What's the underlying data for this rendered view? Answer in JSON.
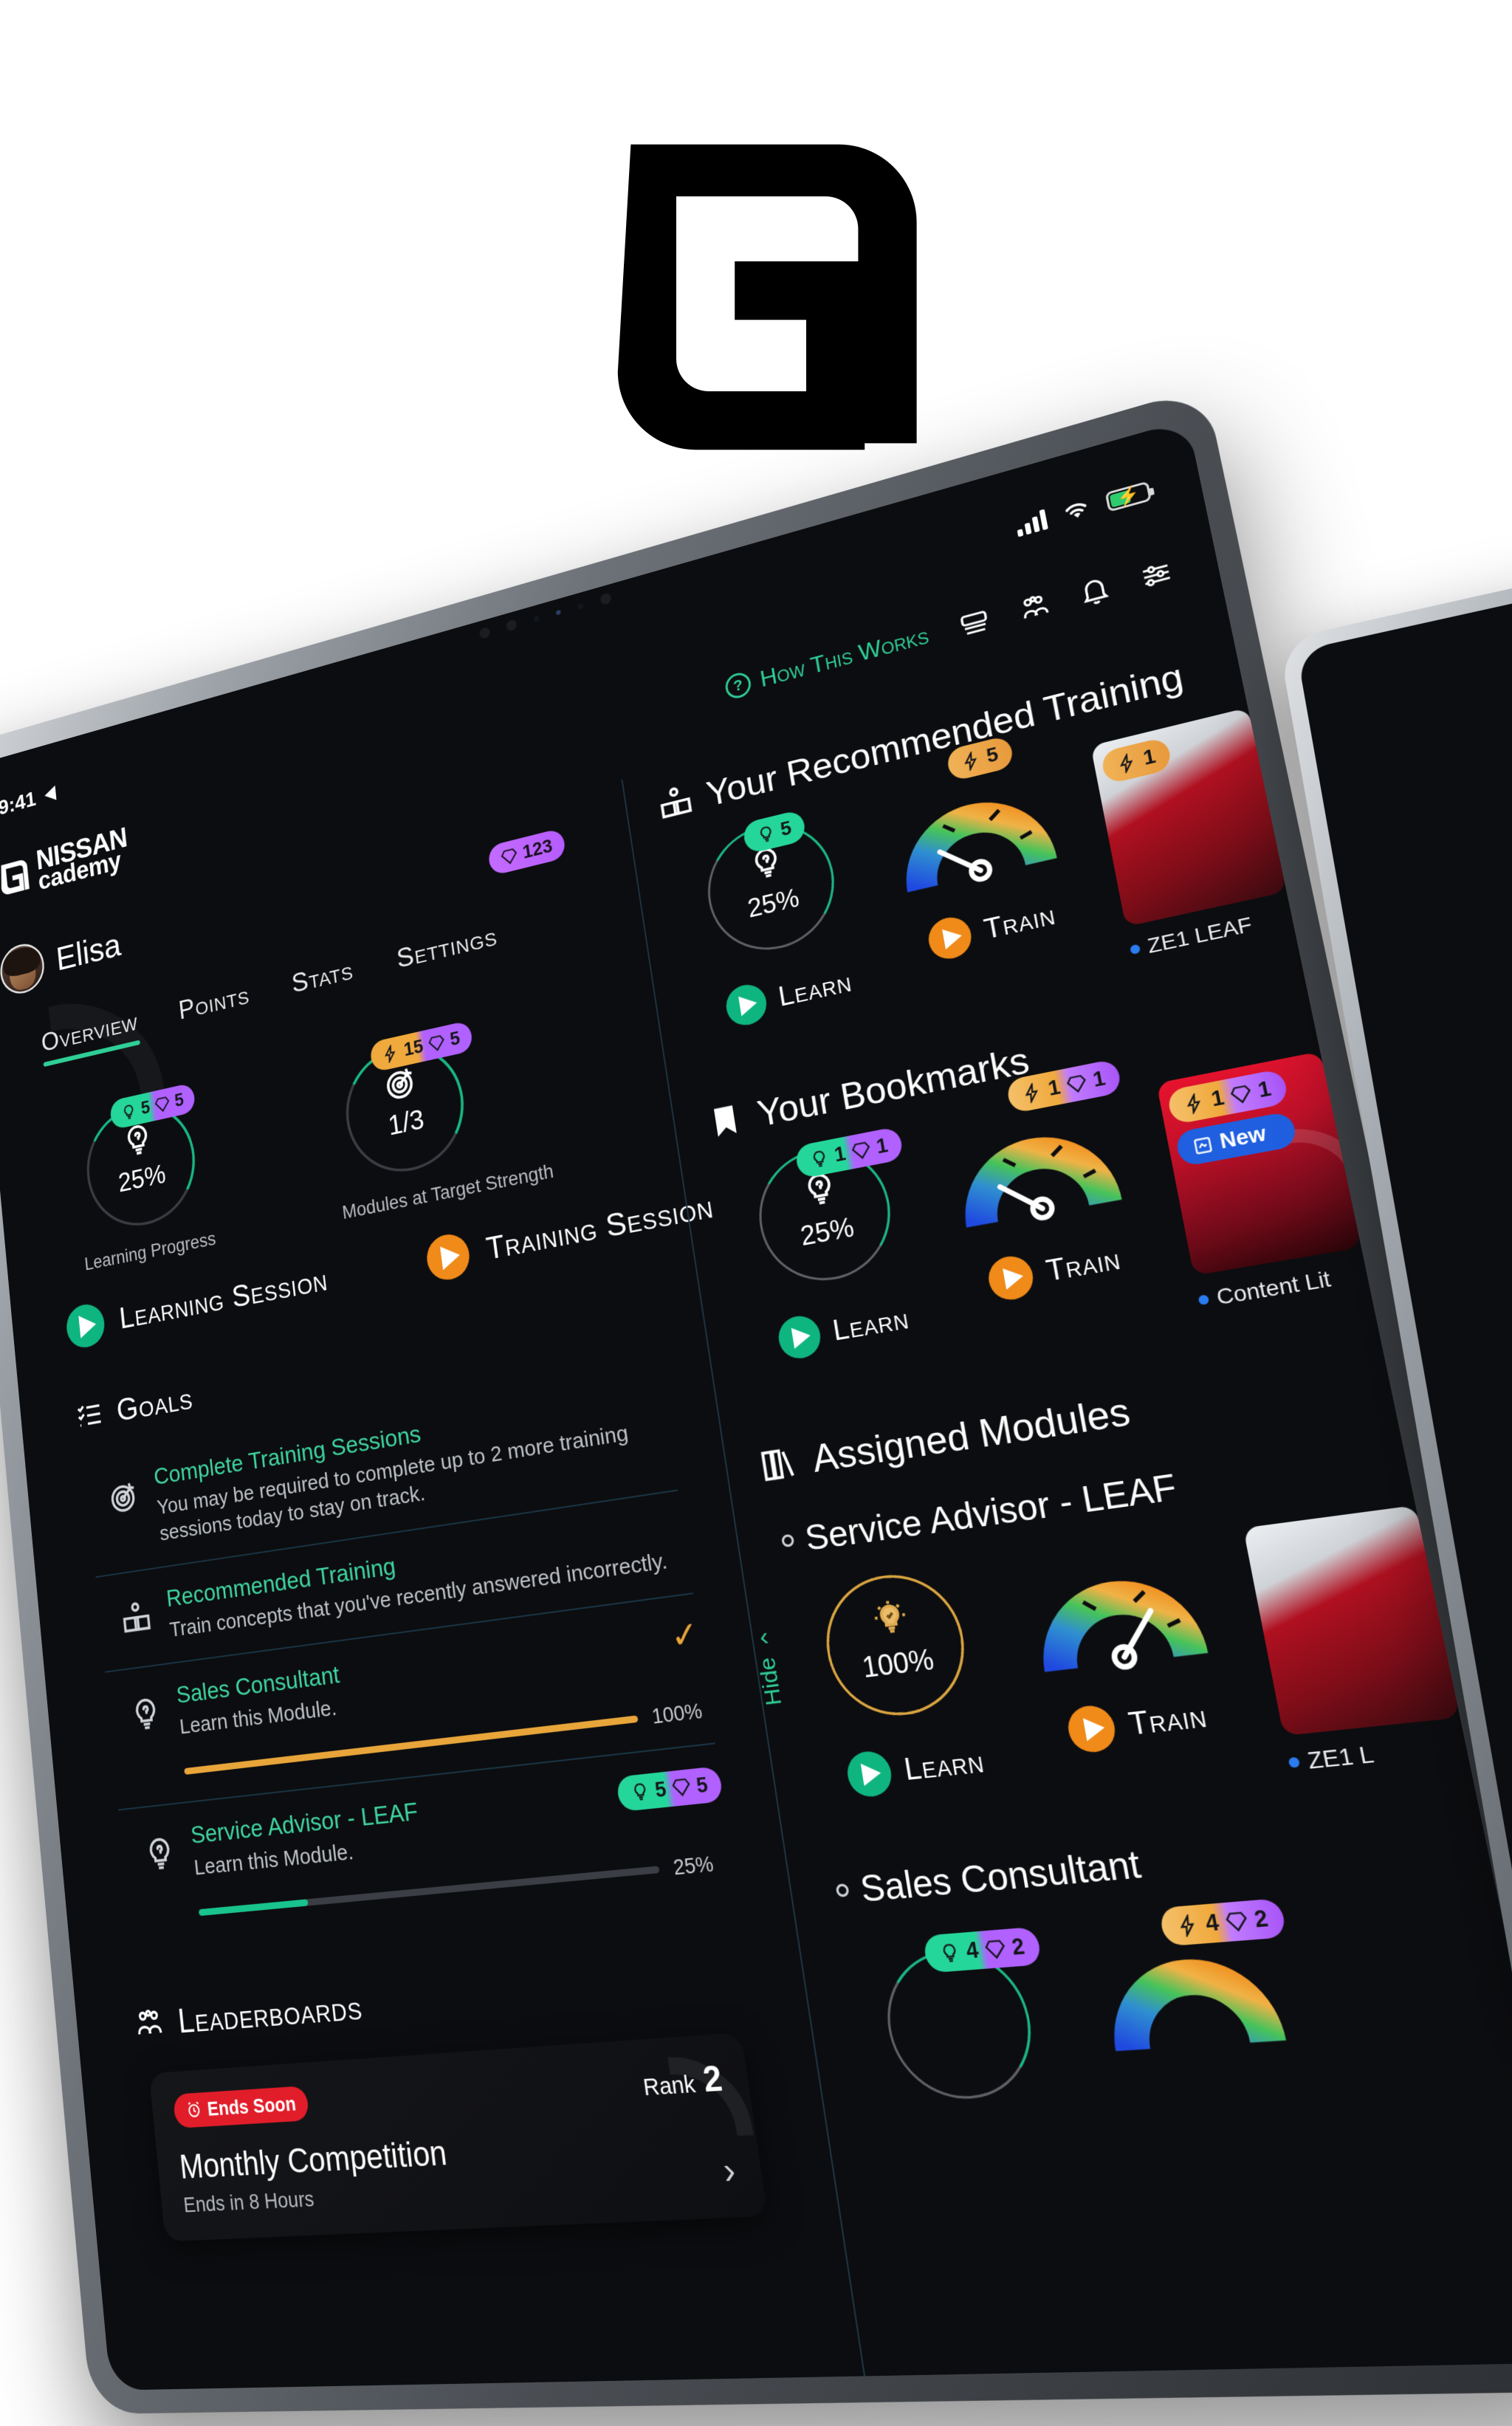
{
  "brand": {
    "logo_alt": "academy-a-logo"
  },
  "status_bar": {
    "time": "9:41",
    "location_arrow": "location-arrow-icon",
    "signal": "cellular-signal-icon",
    "wifi": "wifi-icon",
    "battery": "battery-charging-icon"
  },
  "app_header": {
    "logo_line1": "NISSAN",
    "logo_line2": "cademy",
    "how_this_works": "How This Works",
    "icons": [
      "cards-icon",
      "people-group-icon",
      "bell-icon",
      "sliders-icon"
    ]
  },
  "profile": {
    "name": "Elisa",
    "avatar": "user-avatar"
  },
  "tabs": [
    {
      "label": "Overview",
      "active": true
    },
    {
      "label": "Points",
      "active": false
    },
    {
      "label": "Stats",
      "active": false
    },
    {
      "label": "Settings",
      "active": false
    }
  ],
  "points_badge": {
    "value": "123",
    "icon": "gem-icon"
  },
  "overview_rings": [
    {
      "icon": "lightbulb-question-icon",
      "value": "25%",
      "caption": "Learning Progress",
      "badge": {
        "left_icon": "lightbulb-icon",
        "left_value": "5",
        "right_icon": "gem-icon",
        "right_value": "5"
      }
    },
    {
      "icon": "target-icon",
      "value": "1/3",
      "caption": "Modules at Target Strength",
      "badge": {
        "left_icon": "bolt-icon",
        "left_value": "15",
        "right_icon": "gem-icon",
        "right_value": "5"
      }
    }
  ],
  "session_buttons": [
    {
      "label": "Learning Session",
      "color": "#0fb57f"
    },
    {
      "label": "Training Session",
      "color": "#f08a19"
    }
  ],
  "goals": {
    "header": "Goals",
    "header_icon": "checklist-icon",
    "items": [
      {
        "icon": "target-icon",
        "title": "Complete Training Sessions",
        "desc": "You may be required to complete up to 2 more training sessions today to stay on track.",
        "progress": null,
        "progress_label": null,
        "check": false,
        "badge": null
      },
      {
        "icon": "reading-person-icon",
        "title": "Recommended Training",
        "desc": "Train concepts that you've recently answered incorrectly.",
        "progress": null,
        "progress_label": null,
        "check": false,
        "badge": null
      },
      {
        "icon": "lightbulb-question-icon",
        "title": "Sales Consultant",
        "desc": "Learn this Module.",
        "progress": 100,
        "progress_label": "100%",
        "check": true,
        "badge": null
      },
      {
        "icon": "lightbulb-question-icon",
        "title": "Service Advisor - LEAF",
        "desc": "Learn this Module.",
        "progress": 25,
        "progress_label": "25%",
        "check": false,
        "badge": {
          "left_icon": "lightbulb-icon",
          "left_value": "5",
          "right_icon": "gem-icon",
          "right_value": "5"
        }
      }
    ]
  },
  "leaderboards": {
    "header": "Leaderboards",
    "header_icon": "people-group-icon",
    "card": {
      "ends_soon": "Ends Soon",
      "ends_soon_icon": "alarm-icon",
      "title": "Monthly Competition",
      "subtitle": "Ends in 8 Hours",
      "rank_label": "Rank",
      "rank_value": "2",
      "chevron": "chevron-right-icon"
    }
  },
  "recommended_training": {
    "header": "Your Recommended Training",
    "header_icon": "reading-person-icon",
    "learn": {
      "icon": "lightbulb-question-icon",
      "value": "25%",
      "label": "Learn",
      "badge": {
        "left_icon": "lightbulb-icon",
        "left_value": "5"
      }
    },
    "train": {
      "label": "Train",
      "gauge": "strength-gauge",
      "badge": {
        "left_icon": "bolt-icon",
        "left_value": "5"
      }
    },
    "thumb": {
      "badge": {
        "left_icon": "bolt-icon",
        "left_value": "1"
      },
      "caption": "ZE1 LEAF"
    }
  },
  "bookmarks": {
    "header": "Your Bookmarks",
    "header_icon": "bookmark-icon",
    "learn": {
      "icon": "lightbulb-question-icon",
      "value": "25%",
      "label": "Learn",
      "badge": {
        "left_icon": "lightbulb-icon",
        "left_value": "1",
        "right_icon": "gem-icon",
        "right_value": "1"
      }
    },
    "train": {
      "label": "Train",
      "gauge": "strength-gauge",
      "badge": {
        "left_icon": "bolt-icon",
        "left_value": "1",
        "right_icon": "gem-icon",
        "right_value": "1"
      }
    },
    "thumb": {
      "badge": {
        "left_icon": "bolt-icon",
        "left_value": "1",
        "right_icon": "gem-icon",
        "right_value": "1"
      },
      "new_badge": "New",
      "new_icon": "new-content-icon",
      "caption": "Content Lit"
    }
  },
  "assigned_modules": {
    "header": "Assigned Modules",
    "header_icon": "books-icon",
    "hide_label": "Hide",
    "hide_chevron": "chevron-up-icon",
    "items": [
      {
        "title": "Service Advisor - LEAF",
        "learn": {
          "icon": "lightbulb-check-icon",
          "value": "100%",
          "label": "Learn"
        },
        "train": {
          "label": "Train",
          "gauge": "strength-gauge"
        },
        "thumb_caption": "ZE1 L"
      },
      {
        "title": "Sales Consultant",
        "learn": {
          "label": "Learn",
          "badge": {
            "left_icon": "lightbulb-icon",
            "left_value": "4",
            "right_icon": "gem-icon",
            "right_value": "2"
          }
        },
        "train": {
          "label": "Train",
          "badge": {
            "left_icon": "bolt-icon",
            "left_value": "4",
            "right_icon": "gem-icon",
            "right_value": "2"
          }
        }
      }
    ]
  },
  "colors": {
    "accent_green": "#2fcf96",
    "accent_orange": "#f08a19",
    "accent_purple": "#b061ff",
    "accent_gold": "#e8a53a",
    "accent_red": "#e11d2a",
    "accent_blue": "#1f5fe0",
    "bg_dark": "#0c0d10"
  }
}
